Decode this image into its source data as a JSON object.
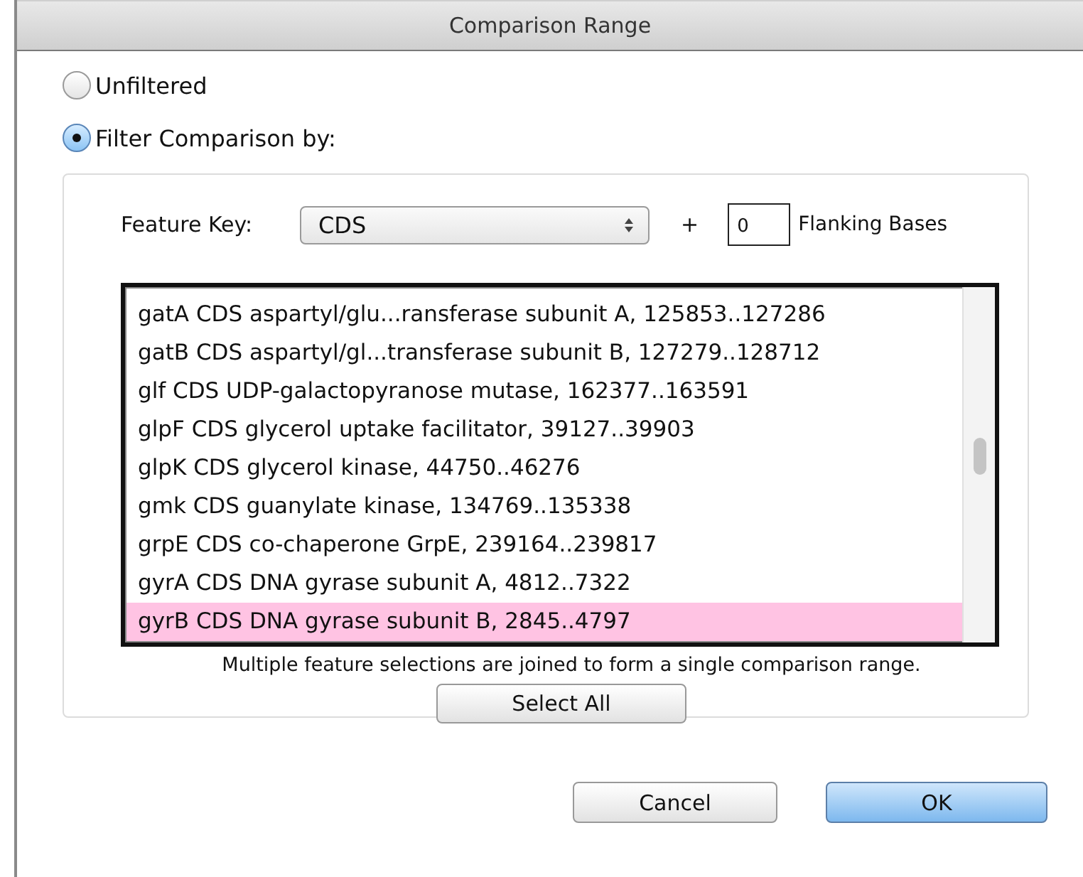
{
  "window": {
    "title": "Comparison Range"
  },
  "options": [
    {
      "label": "Unfiltered",
      "selected": false
    },
    {
      "label": "Filter Comparison by:",
      "selected": true
    }
  ],
  "feature_key": {
    "label": "Feature Key:",
    "value": "CDS",
    "plus": "+",
    "flanking_value": "0",
    "flanking_label": "Flanking Bases"
  },
  "features": [
    {
      "text": "gatA CDS aspartyl/glu...ransferase subunit A, 125853..127286",
      "selected": false
    },
    {
      "text": "gatB CDS aspartyl/gl...transferase subunit B, 127279..128712",
      "selected": false
    },
    {
      "text": "glf CDS UDP-galactopyranose mutase, 162377..163591",
      "selected": false
    },
    {
      "text": "glpF CDS glycerol uptake facilitator, 39127..39903",
      "selected": false
    },
    {
      "text": "glpK CDS glycerol kinase, 44750..46276",
      "selected": false
    },
    {
      "text": "gmk CDS guanylate kinase, 134769..135338",
      "selected": false
    },
    {
      "text": "grpE CDS co-chaperone GrpE, 239164..239817",
      "selected": false
    },
    {
      "text": "gyrA CDS DNA gyrase subunit A, 4812..7322",
      "selected": false
    },
    {
      "text": "gyrB CDS DNA gyrase subunit B, 2845..4797",
      "selected": true
    }
  ],
  "note": "Multiple feature selections are joined to form a single comparison range.",
  "select_all": "Select All",
  "buttons": [
    {
      "label": "Cancel",
      "kind": "normal"
    },
    {
      "label": "OK",
      "kind": "default"
    }
  ]
}
